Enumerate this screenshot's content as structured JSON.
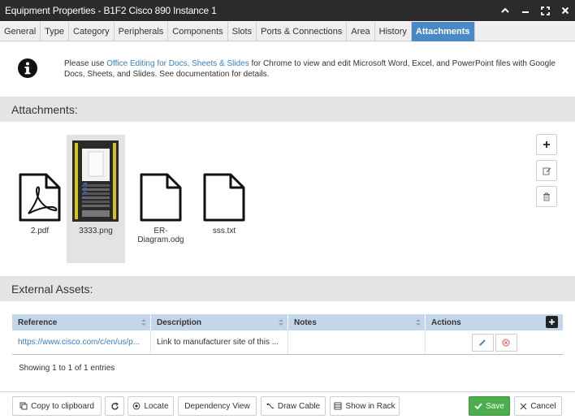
{
  "window": {
    "title": "Equipment Properties - B1F2 Cisco 890 Instance 1"
  },
  "tabs": [
    {
      "label": "General"
    },
    {
      "label": "Type"
    },
    {
      "label": "Category"
    },
    {
      "label": "Peripherals"
    },
    {
      "label": "Components"
    },
    {
      "label": "Slots"
    },
    {
      "label": "Ports & Connections"
    },
    {
      "label": "Area"
    },
    {
      "label": "History"
    },
    {
      "label": "Attachments"
    }
  ],
  "active_tab": "Attachments",
  "info": {
    "prefix": "Please use ",
    "link": "Office Editing for Docs, Sheets & Slides",
    "suffix": " for Chrome to view and edit Microsoft Word, Excel, and PowerPoint files with Google Docs, Sheets, and Slides. See documentation for details."
  },
  "attachments": {
    "header": "Attachments:",
    "files": [
      {
        "name": "2.pdf",
        "icon": "pdf-file-icon"
      },
      {
        "name": "3333.png",
        "icon": "image-thumbnail"
      },
      {
        "name": "ER-Diagram.odg",
        "icon": "file-icon"
      },
      {
        "name": "sss.txt",
        "icon": "file-icon"
      }
    ]
  },
  "external": {
    "header": "External Assets:",
    "columns": [
      "Reference",
      "Description",
      "Notes",
      "Actions"
    ],
    "rows": [
      {
        "reference": "https://www.cisco.com/c/en/us/p...",
        "description": "Link to manufacturer site of this ...",
        "notes": ""
      }
    ],
    "entries": "Showing 1 to 1 of 1 entries"
  },
  "footer": {
    "copy": "Copy to clipboard",
    "locate": "Locate",
    "dependency": "Dependency View",
    "draw_cable": "Draw Cable",
    "show_rack": "Show in Rack",
    "save": "Save",
    "cancel": "Cancel"
  },
  "colors": {
    "accent": "#4a89c8",
    "save": "#4cae4c",
    "titlebar": "#2b2b2b"
  }
}
